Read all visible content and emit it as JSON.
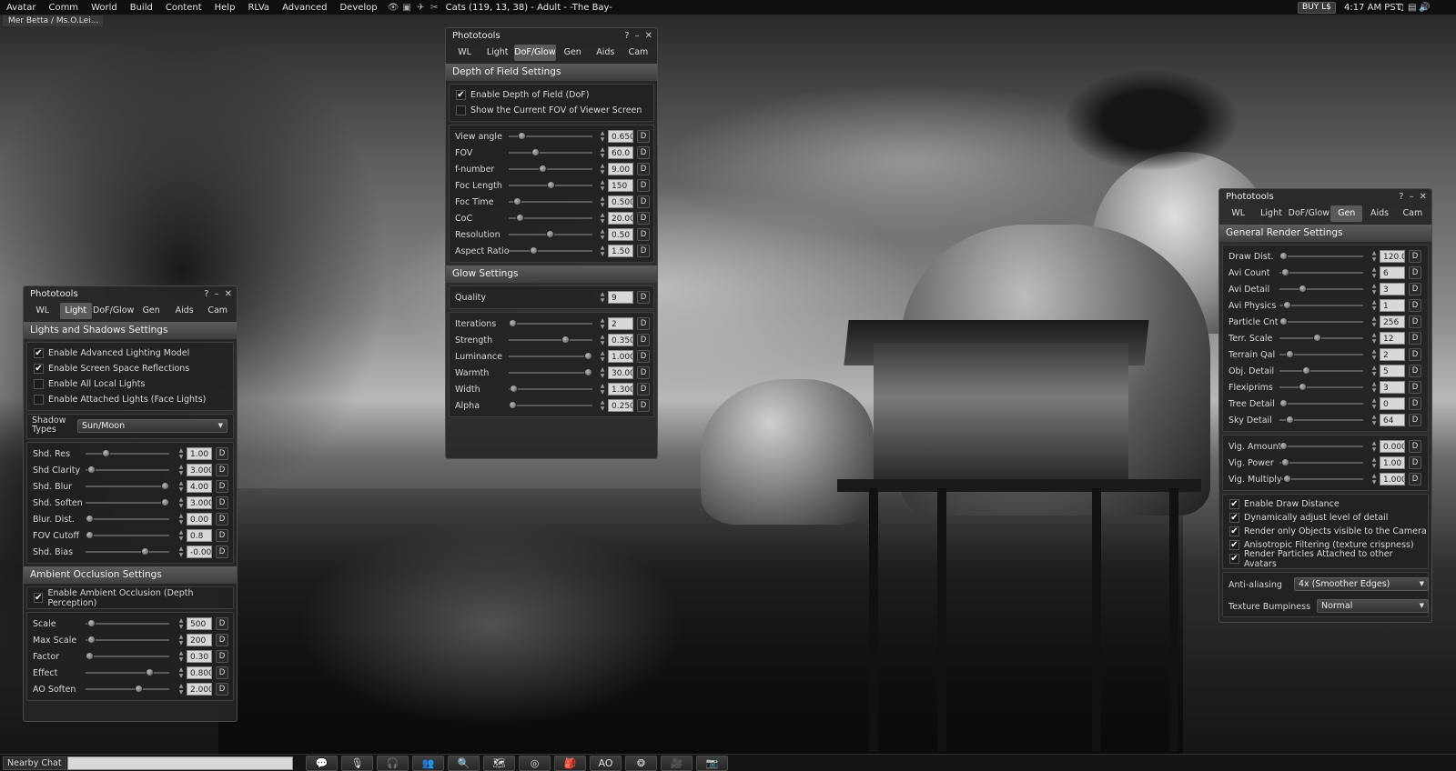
{
  "topbar": {
    "menus": [
      "Avatar",
      "Comm",
      "World",
      "Build",
      "Content",
      "Help",
      "RLVa",
      "Advanced",
      "Develop"
    ],
    "location": "Cats (119, 13, 38) - Adult - -The Bay-",
    "buy_label": "BUY L$",
    "clock": "4:17 AM PST"
  },
  "nav_tab": "Mer Betta / Ms.O.Lei...",
  "tabs": [
    "WL",
    "Light",
    "DoF/Glow",
    "Gen",
    "Aids",
    "Cam"
  ],
  "dof_panel": {
    "title": "Phototools",
    "active_tab": "DoF/Glow",
    "section1": "Depth of Field Settings",
    "checks": [
      {
        "label": "Enable Depth of Field (DoF)",
        "checked": true
      },
      {
        "label": "Show the Current FOV of Viewer Screen",
        "checked": false
      }
    ],
    "sliders": [
      {
        "label": "View angle",
        "value": "0.650",
        "pos": 0.12
      },
      {
        "label": "FOV",
        "value": "60.0",
        "pos": 0.3
      },
      {
        "label": "f-number",
        "value": "9.00",
        "pos": 0.4
      },
      {
        "label": "Foc Length",
        "value": "150",
        "pos": 0.5
      },
      {
        "label": "Foc Time",
        "value": "0.500",
        "pos": 0.06
      },
      {
        "label": "CoC",
        "value": "20.00",
        "pos": 0.1
      },
      {
        "label": "Resolution",
        "value": "0.50",
        "pos": 0.49
      },
      {
        "label": "Aspect Ratio",
        "value": "1.50",
        "pos": 0.28
      }
    ],
    "section2": "Glow Settings",
    "quality_label": "Quality",
    "quality_value": "9",
    "glow_sliders": [
      {
        "label": "Iterations",
        "value": "2",
        "pos": 0.0
      },
      {
        "label": "Strength",
        "value": "0.350",
        "pos": 0.7
      },
      {
        "label": "Luminance",
        "value": "1.000",
        "pos": 1.0
      },
      {
        "label": "Warmth",
        "value": "30.00",
        "pos": 1.0
      },
      {
        "label": "Width",
        "value": "1.300",
        "pos": 0.01
      },
      {
        "label": "Alpha",
        "value": "0.250",
        "pos": 0.0
      }
    ]
  },
  "light_panel": {
    "title": "Phototools",
    "active_tab": "Light",
    "section1": "Lights and Shadows Settings",
    "checks": [
      {
        "label": "Enable Advanced Lighting Model",
        "checked": true
      },
      {
        "label": "Enable Screen Space Reflections",
        "checked": true
      },
      {
        "label": "Enable All Local Lights",
        "checked": false
      },
      {
        "label": "Enable Attached Lights (Face Lights)",
        "checked": false
      }
    ],
    "shadow_types_label": "Shadow Types",
    "shadow_types_value": "Sun/Moon",
    "sliders": [
      {
        "label": "Shd. Res",
        "value": "1.00",
        "pos": 0.22
      },
      {
        "label": "Shd Clarity",
        "value": "3.000",
        "pos": 0.02
      },
      {
        "label": "Shd. Blur",
        "value": "4.00",
        "pos": 1.0
      },
      {
        "label": "Shd. Soften",
        "value": "3.000",
        "pos": 1.0
      },
      {
        "label": "Blur. Dist.",
        "value": "0.00",
        "pos": 0.0
      },
      {
        "label": "FOV Cutoff",
        "value": "0.8",
        "pos": 0.0
      },
      {
        "label": "Shd. Bias",
        "value": "-0.002",
        "pos": 0.73
      }
    ],
    "section2": "Ambient Occlusion Settings",
    "ao_check": {
      "label": "Enable Ambient Occlusion (Depth Perception)",
      "checked": true
    },
    "ao_sliders": [
      {
        "label": "Scale",
        "value": "500",
        "pos": 0.02
      },
      {
        "label": "Max Scale",
        "value": "200",
        "pos": 0.02
      },
      {
        "label": "Factor",
        "value": "0.30",
        "pos": 0.0
      },
      {
        "label": "Effect",
        "value": "0.800",
        "pos": 0.8
      },
      {
        "label": "AO Soften",
        "value": "2.000",
        "pos": 0.65
      }
    ]
  },
  "gen_panel": {
    "title": "Phototools",
    "active_tab": "Gen",
    "section1": "General Render Settings",
    "sliders": [
      {
        "label": "Draw Dist.",
        "value": "120.0",
        "pos": 0.0
      },
      {
        "label": "Avi Count",
        "value": "6",
        "pos": 0.02
      },
      {
        "label": "Avi Detail",
        "value": "3",
        "pos": 0.25
      },
      {
        "label": "Avi Physics",
        "value": "1",
        "pos": 0.05
      },
      {
        "label": "Particle Cnt",
        "value": "256",
        "pos": 0.0
      },
      {
        "label": "Terr. Scale",
        "value": "12",
        "pos": 0.45
      },
      {
        "label": "Terrain Qal",
        "value": "2",
        "pos": 0.08
      },
      {
        "label": "Obj. Detail",
        "value": "5",
        "pos": 0.3
      },
      {
        "label": "Flexiprims",
        "value": "3",
        "pos": 0.25
      },
      {
        "label": "Tree Detail",
        "value": "0",
        "pos": 0.0
      },
      {
        "label": "Sky Detail",
        "value": "64",
        "pos": 0.08
      }
    ],
    "vig_sliders": [
      {
        "label": "Vig. Amount",
        "value": "0.000",
        "pos": 0.0
      },
      {
        "label": "Vig. Power",
        "value": "1.00",
        "pos": 0.02
      },
      {
        "label": "Vig. Multiply",
        "value": "1.000",
        "pos": 0.05
      }
    ],
    "checks": [
      {
        "label": "Enable Draw Distance",
        "checked": true
      },
      {
        "label": "Dynamically adjust level of detail",
        "checked": true
      },
      {
        "label": "Render only Objects visible to the Camera",
        "checked": true
      },
      {
        "label": "Anisotropic Filtering (texture crispness)",
        "checked": true
      },
      {
        "label": "Render Particles Attached to other Avatars",
        "checked": true
      }
    ],
    "aa_label": "Anti-aliasing",
    "aa_value": "4x (Smoother Edges)",
    "bump_label": "Texture Bumpiness",
    "bump_value": "Normal"
  },
  "bottombar": {
    "nearby_chat": "Nearby Chat",
    "ao_label": "AO",
    "buttons": [
      "speech-bubble-icon",
      "microphone-icon",
      "headphones-icon",
      "people-icon",
      "search-icon",
      "map-icon",
      "radar-icon",
      "inventory-icon",
      "ao-button",
      "snapshot-aperture-icon",
      "video-camera-icon",
      "photo-camera-icon"
    ]
  },
  "controls": {
    "help": "?",
    "minimize": "–",
    "close": "✕",
    "default_btn": "D",
    "spin_up": "▲",
    "spin_down": "▼",
    "dropdown": "▼",
    "check": "✔"
  }
}
